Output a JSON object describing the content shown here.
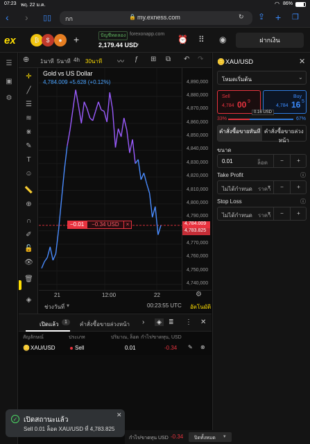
{
  "status_bar": {
    "time": "07:23",
    "date": "พฤ. 22 ม.ค.",
    "battery": "86%"
  },
  "safari": {
    "aa": "กก",
    "url": "my.exness.com"
  },
  "header": {
    "account_type": "ปัญชีทดลอง",
    "server": "forexonapp.com",
    "balance": "2,179.44 USD",
    "deposit_label": "ฝากเงิน"
  },
  "chart_toolbar": {
    "timeframes": [
      "1นาที",
      "5นาที",
      "4h",
      "30นาที"
    ],
    "active_timeframe": "30นาที"
  },
  "chart": {
    "title": "Gold vs US Dollar",
    "subtitle": "4,784.009  +5.628 (+0.12%)",
    "position_line": {
      "pnl_badge": "−0.01",
      "pnl_value": "−0.34 USD",
      "close": "×"
    },
    "price_label_1": "4,784.009",
    "price_label_2": "4,783.825",
    "footer_period": "ช่วงวันที่",
    "footer_time": "00:23:55 UTC",
    "footer_auto": "อัตโนมัติ"
  },
  "chart_data": {
    "type": "line",
    "ylim": [
      4740,
      4895
    ],
    "yticks": [
      "4,890,000",
      "4,880,000",
      "4,870,000",
      "4,860,000",
      "4,850,000",
      "4,840,000",
      "4,830,000",
      "4,820,000",
      "4,810,000",
      "4,800,000",
      "4,790,000",
      "4,780,000",
      "4,770,000",
      "4,760,000",
      "4,750,000",
      "4,740,000"
    ],
    "xticks": [
      "21",
      "12:00",
      "22"
    ],
    "values": [
      4752,
      4757,
      4760,
      4768,
      4758,
      4763,
      4781,
      4803,
      4825,
      4843,
      4855,
      4870,
      4885,
      4873,
      4860,
      4876,
      4871,
      4864,
      4862,
      4869,
      4876,
      4870,
      4869,
      4861,
      4883,
      4870,
      4842,
      4856,
      4850,
      4864,
      4855,
      4838,
      4848,
      4830,
      4833,
      4818,
      4823,
      4815,
      4808,
      4790,
      4798,
      4777,
      4784
    ],
    "colors": {
      "up": "#9b5cff",
      "down": "#4a8cff"
    }
  },
  "panel": {
    "symbol": "XAU/USD",
    "mode": "โหมดเริ่มต้น",
    "sell_label": "Sell",
    "sell_price_main": "4,784",
    "sell_price_big": "00",
    "sell_price_sup": "9",
    "buy_label": "Buy",
    "buy_price_main": "4,784",
    "buy_price_big": "16",
    "buy_price_sup": "5",
    "spread": "0.16 USD",
    "sell_pct": "33%",
    "buy_pct": "67%",
    "market_order": "คำสั่งซื้อขายทันที",
    "pending_order": "คำสั่งซื้อขายล่วงหน้า",
    "volume_label": "ขนาด",
    "volume_value": "0.01",
    "volume_unit": "ล็อต",
    "tp_label": "Take Profit",
    "tp_placeholder": "ไม่ได้กำหนด",
    "tp_mode": "ราคา",
    "sl_label": "Stop Loss",
    "sl_placeholder": "ไม่ได้กำหนด",
    "sl_mode": "ราคา"
  },
  "positions": {
    "tab_open": "เปิดแล้ว",
    "tab_open_count": "1",
    "tab_pending": "คำสั่งซื้อขายล่วงหน้า",
    "headers": [
      "สัญลักษณ์",
      "ประเภท",
      "ปริมาณ, ล็อต",
      "กำไร/ขาดทุน, USD"
    ],
    "row": {
      "symbol": "XAU/USD",
      "type": "Sell",
      "volume": "0.01",
      "pnl": "-0.34"
    }
  },
  "toast": {
    "title": "เปิดสถานะแล้ว",
    "body": "Sell 0.01 ล็อต XAU/USD ที่ 4,783.825"
  },
  "footer": {
    "pnl_label": "กำไร/ขาดทุน USD",
    "pnl_value": "-0.34",
    "close_all": "ปิดทั้งหมด"
  }
}
